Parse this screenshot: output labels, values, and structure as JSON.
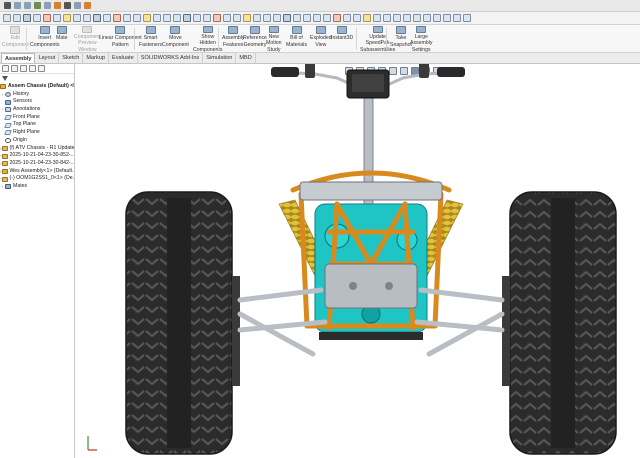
{
  "ribbon": {
    "buttons": [
      {
        "label": "Edit\nComponent",
        "disabled": true
      },
      {
        "label": "Insert\nComponents",
        "disabled": false
      },
      {
        "label": "Mate",
        "disabled": false
      },
      {
        "label": "Component\nPreview\nWindow",
        "disabled": true
      },
      {
        "label": "Linear Component\nPattern",
        "disabled": false
      },
      {
        "label": "Smart\nFasteners",
        "disabled": false
      },
      {
        "label": "Move\nComponent",
        "disabled": false
      },
      {
        "label": "Show\nHidden\nComponents",
        "disabled": false
      },
      {
        "label": "Assembly\nFeatures",
        "disabled": false
      },
      {
        "label": "Reference\nGeometry",
        "disabled": false
      },
      {
        "label": "New\nMotion\nStudy",
        "disabled": false
      },
      {
        "label": "Bill of\nMaterials",
        "disabled": false
      },
      {
        "label": "Exploded\nView",
        "disabled": false
      },
      {
        "label": "Instant3D",
        "disabled": false
      },
      {
        "label": "Update\nSpeedPak\nSubassemblies",
        "disabled": false
      },
      {
        "label": "Take\nSnapshot",
        "disabled": false
      },
      {
        "label": "Large\nAssembly\nSettings",
        "disabled": false
      }
    ]
  },
  "tabs": [
    {
      "label": "Assembly",
      "active": true
    },
    {
      "label": "Layout",
      "active": false
    },
    {
      "label": "Sketch",
      "active": false
    },
    {
      "label": "Markup",
      "active": false
    },
    {
      "label": "Evaluate",
      "active": false
    },
    {
      "label": "SOLIDWORKS Add-Ins",
      "active": false
    },
    {
      "label": "Simulation",
      "active": false
    },
    {
      "label": "MBD",
      "active": false
    }
  ],
  "tree": {
    "items": [
      {
        "label": "Assem Chassis (Default) <Displ...",
        "icon": "asm",
        "expand": "",
        "root": true
      },
      {
        "label": "History",
        "icon": "hist",
        "expand": "›"
      },
      {
        "label": "Sensors",
        "icon": "sens",
        "expand": ""
      },
      {
        "label": "Annotations",
        "icon": "ann",
        "expand": "›"
      },
      {
        "label": "Front Plane",
        "icon": "plane",
        "expand": ""
      },
      {
        "label": "Top Plane",
        "icon": "plane",
        "expand": ""
      },
      {
        "label": "Right Plane",
        "icon": "plane",
        "expand": ""
      },
      {
        "label": "Origin",
        "icon": "orig",
        "expand": ""
      },
      {
        "label": "(f) ATV Chassis - R1 Updated...",
        "icon": "part",
        "expand": "›"
      },
      {
        "label": "2025-10-21-04-23-30-852-...",
        "icon": "part",
        "expand": "›"
      },
      {
        "label": "2025-10-21-04-23-30-842-...",
        "icon": "part",
        "expand": "›"
      },
      {
        "label": "Wes Assembly<1> (Default...",
        "icon": "asm",
        "expand": "›"
      },
      {
        "label": "(-) OOM1G2SS1_0<1> (De...",
        "icon": "part",
        "expand": "›"
      },
      {
        "label": "Mates",
        "icon": "mate",
        "expand": "›"
      }
    ]
  },
  "colors": {
    "tire": "#2b2b2b",
    "tread": "#4a4a4a",
    "rim": "#3a3a3a",
    "frame": "#d98a1e",
    "engine": "#1fc4c4",
    "spring": "#e3c23a",
    "metal": "#b9bec4",
    "steel_dark": "#7d8389"
  }
}
